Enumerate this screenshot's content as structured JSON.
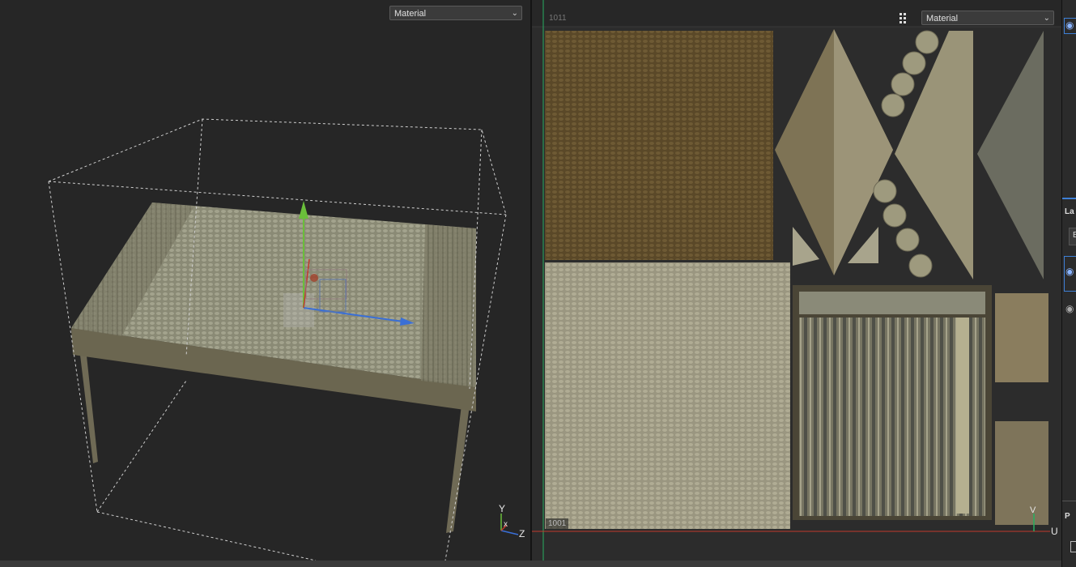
{
  "viewport3d": {
    "mode_label": "Material",
    "gizmo_axes": {
      "y": "Y",
      "x": "x",
      "z": "Z"
    }
  },
  "viewport_uv": {
    "mode_label": "Material",
    "udim_top": "1011",
    "udim_bottom": "1001",
    "axis_v": "V",
    "axis_u": "U"
  },
  "right_panel": {
    "label_la": "La",
    "label_b": "B",
    "label_p": "P"
  },
  "colors": {
    "accent": "#3d7fd6",
    "u_axis": "#c0392b",
    "v_axis": "#27ae60"
  }
}
